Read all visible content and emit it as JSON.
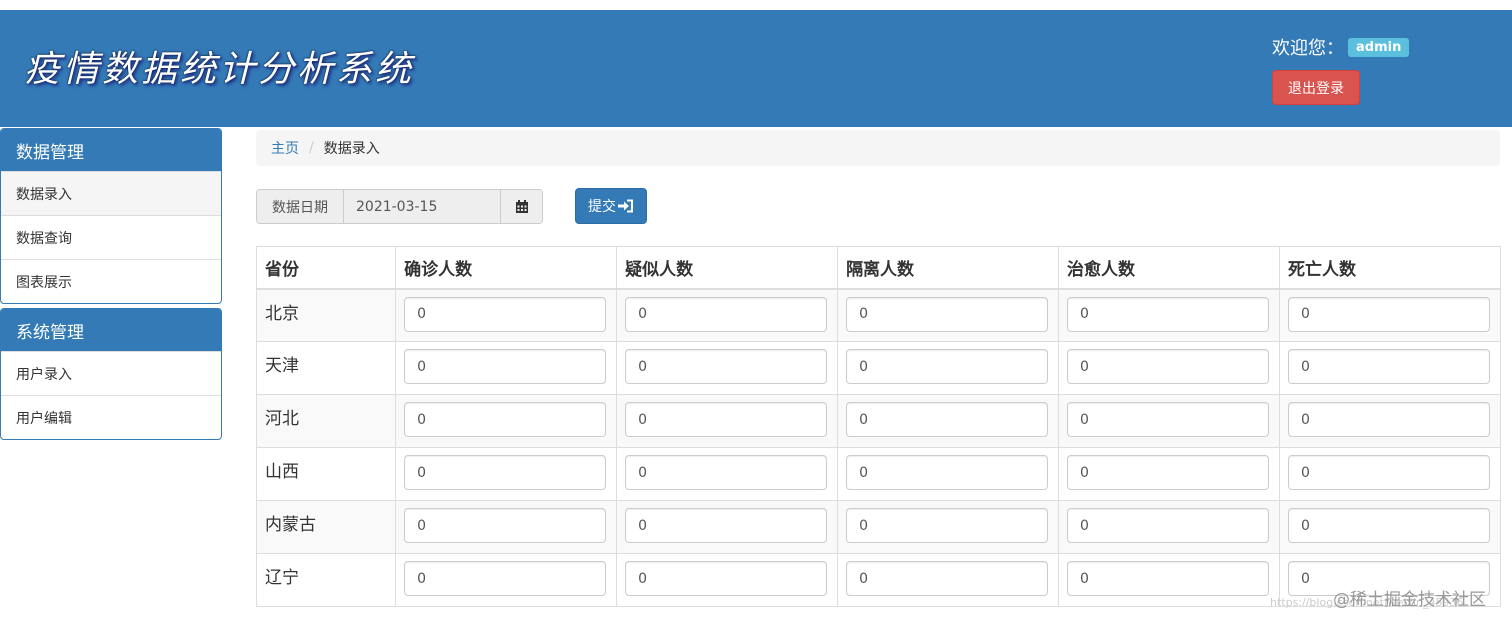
{
  "header": {
    "title": "疫情数据统计分析系统",
    "welcome_label": "欢迎您：",
    "username": "admin",
    "logout_label": "退出登录"
  },
  "sidebar": {
    "groups": [
      {
        "title": "数据管理",
        "items": [
          {
            "label": "数据录入"
          },
          {
            "label": "数据查询"
          },
          {
            "label": "图表展示"
          }
        ]
      },
      {
        "title": "系统管理",
        "items": [
          {
            "label": "用户录入"
          },
          {
            "label": "用户编辑"
          }
        ]
      }
    ]
  },
  "breadcrumb": {
    "home": "主页",
    "separator": "/",
    "current": "数据录入"
  },
  "form": {
    "date_label": "数据日期",
    "date_value": "2021-03-15",
    "submit_label": "提交"
  },
  "table": {
    "headers": [
      "省份",
      "确诊人数",
      "疑似人数",
      "隔离人数",
      "治愈人数",
      "死亡人数"
    ],
    "rows": [
      {
        "province": "北京",
        "values": [
          "0",
          "0",
          "0",
          "0",
          "0"
        ]
      },
      {
        "province": "天津",
        "values": [
          "0",
          "0",
          "0",
          "0",
          "0"
        ]
      },
      {
        "province": "河北",
        "values": [
          "0",
          "0",
          "0",
          "0",
          "0"
        ]
      },
      {
        "province": "山西",
        "values": [
          "0",
          "0",
          "0",
          "0",
          "0"
        ]
      },
      {
        "province": "内蒙古",
        "values": [
          "0",
          "0",
          "0",
          "0",
          "0"
        ]
      },
      {
        "province": "辽宁",
        "values": [
          "0",
          "0",
          "0",
          "0",
          "0"
        ]
      }
    ]
  },
  "watermark": {
    "url": "https://blog.csdn.net/weixin_45936",
    "text": "@稀土掘金技术社区"
  },
  "colors": {
    "primary": "#337ab7",
    "danger": "#d9534f",
    "info": "#5bc0de"
  }
}
